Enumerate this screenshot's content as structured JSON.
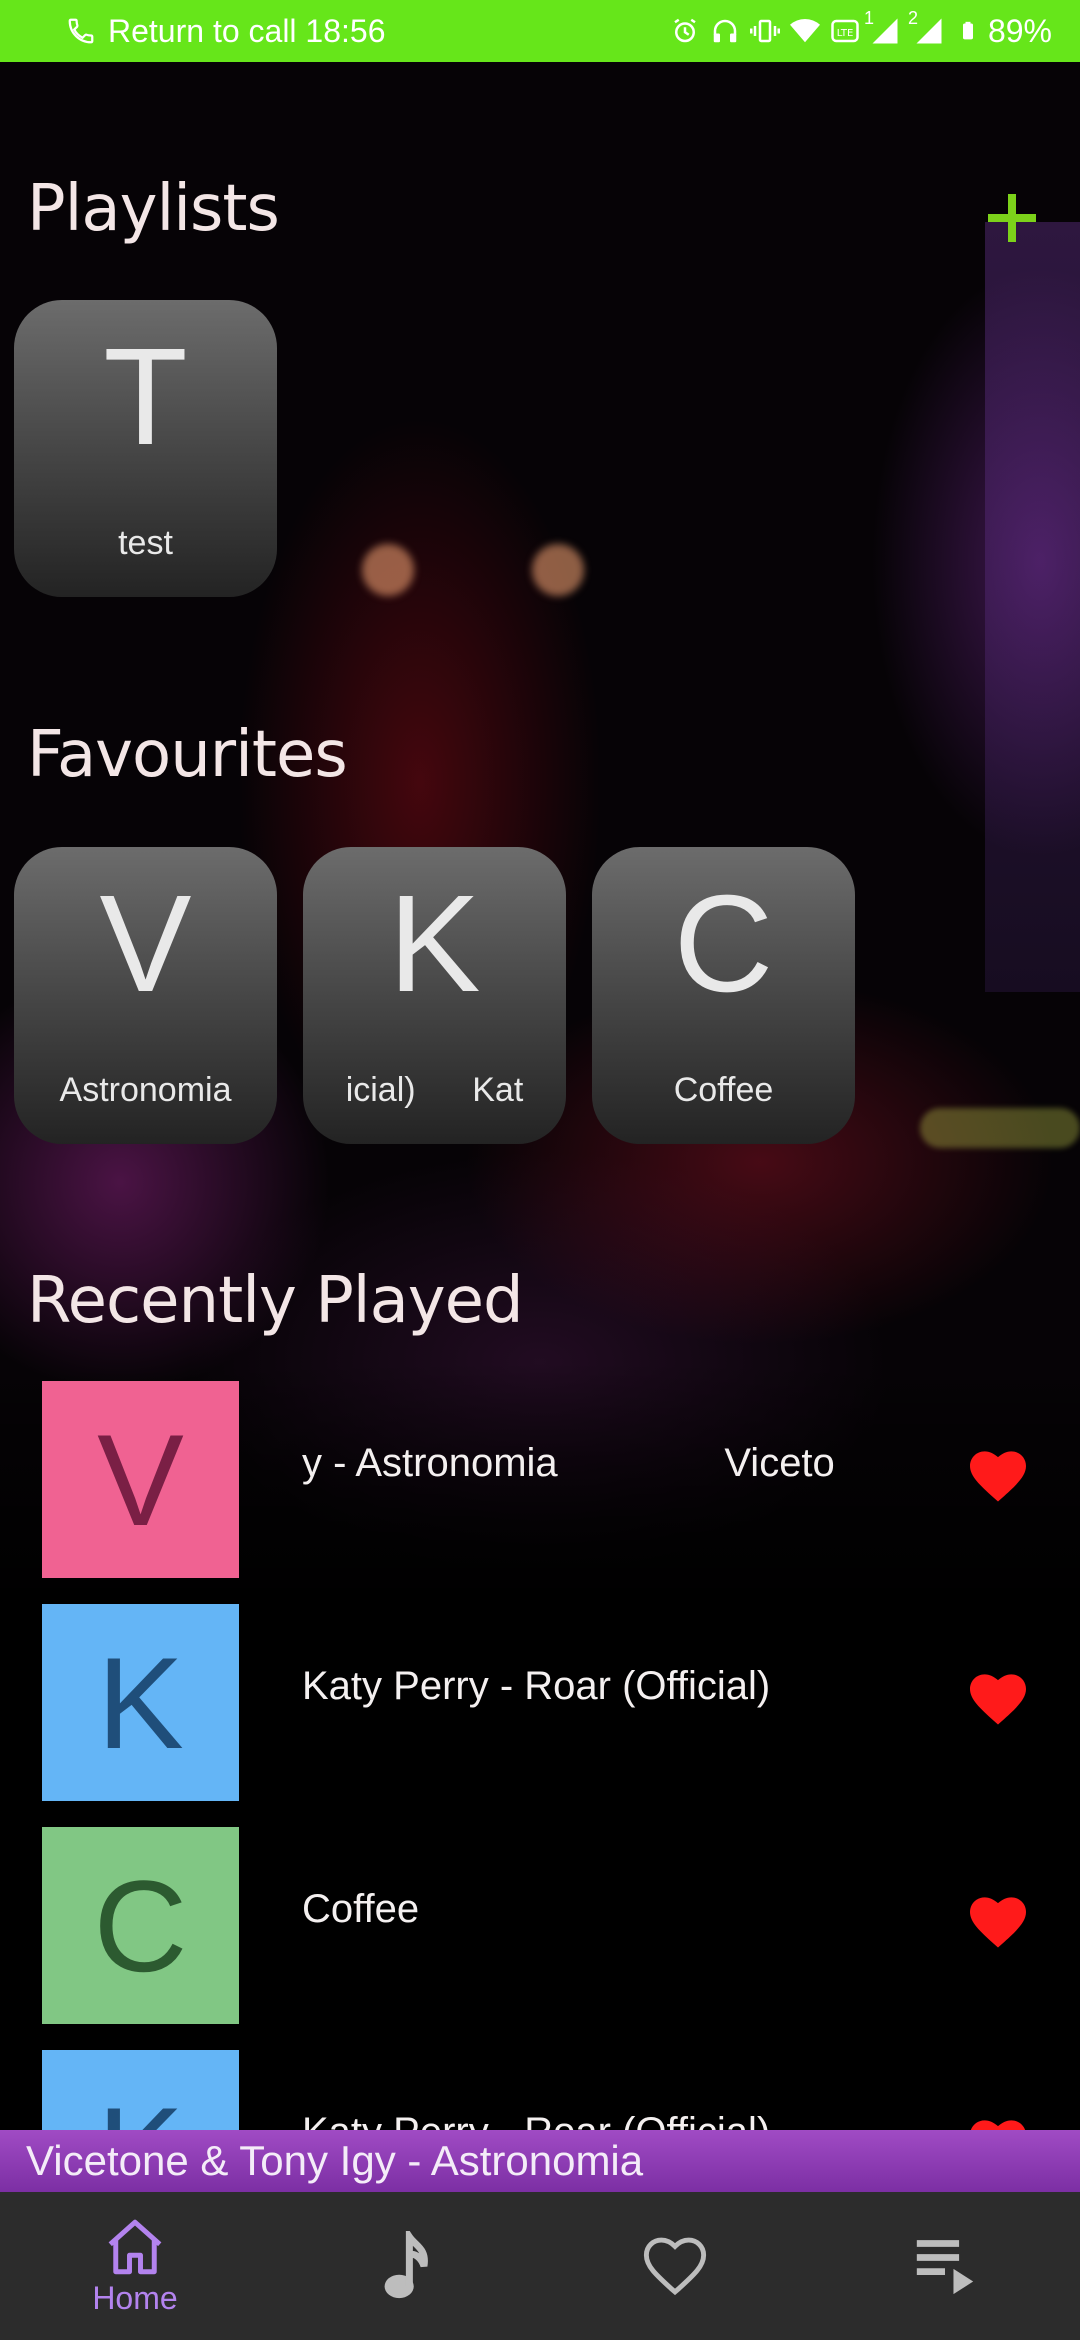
{
  "status_bar": {
    "call_text": "Return to call 18:56",
    "battery": "89%",
    "icons": [
      "phone-icon",
      "alarm-icon",
      "headphones-icon",
      "vibrate-icon",
      "wifi-icon",
      "volte-icon",
      "signal-icon",
      "signal-icon",
      "battery-icon"
    ],
    "sim_badge_1": "1",
    "sim_badge_2": "2"
  },
  "playlists": {
    "title": "Playlists",
    "add_icon": "plus-icon",
    "items": [
      {
        "letter": "T",
        "name": "test"
      }
    ]
  },
  "favourites": {
    "title": "Favourites",
    "items": [
      {
        "letter": "V",
        "name": "Astronomia"
      },
      {
        "letter": "K",
        "name": "icial)      Kat"
      },
      {
        "letter": "C",
        "name": "Coffee"
      }
    ]
  },
  "recent": {
    "title": "Recently Played",
    "items": [
      {
        "letter": "V",
        "title": "y - Astronomia               Viceto",
        "bg": "#f06292",
        "fg": "#7a1f45"
      },
      {
        "letter": "K",
        "title": "Katy Perry - Roar (Official)",
        "bg": "#64b5f6",
        "fg": "#1f4e7a"
      },
      {
        "letter": "C",
        "title": "Coffee",
        "bg": "#81c784",
        "fg": "#2c5a30"
      },
      {
        "letter": "K",
        "title": "Katy Perry - Roar (Official)",
        "bg": "#64b5f6",
        "fg": "#1f4e7a"
      }
    ]
  },
  "now_playing": {
    "title": "Vicetone & Tony Igy - Astronomia"
  },
  "nav": {
    "items": [
      {
        "label": "Home",
        "icon": "home-icon",
        "active": true
      },
      {
        "label": "",
        "icon": "music-note-icon",
        "active": false
      },
      {
        "label": "",
        "icon": "heart-outline-icon",
        "active": false
      },
      {
        "label": "",
        "icon": "queue-icon",
        "active": false
      }
    ]
  },
  "colors": {
    "status_bar": "#66e61a",
    "accent_green": "#7cd21a",
    "heart": "#ff1a1a",
    "now_playing_bar": "#8e3db4",
    "nav_active": "#b383ee",
    "nav_inactive": "#bdbdbd"
  }
}
